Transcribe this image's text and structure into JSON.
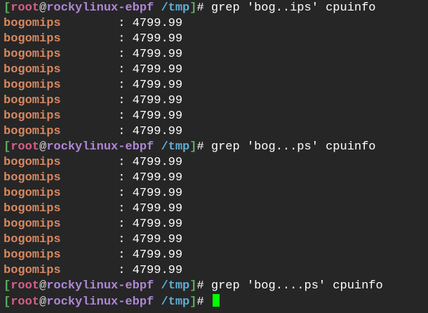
{
  "prompt": {
    "open": "[",
    "user": "root",
    "at": "@",
    "host": "rockylinux-ebpf",
    "path": "/tmp",
    "close": "]",
    "symbol": "# "
  },
  "lines": [
    {
      "type": "prompt",
      "command": "grep 'bog..ips' cpuinfo"
    },
    {
      "type": "output",
      "key": "bogomips",
      "sep": "        : ",
      "value": "4799.99"
    },
    {
      "type": "output",
      "key": "bogomips",
      "sep": "        : ",
      "value": "4799.99"
    },
    {
      "type": "output",
      "key": "bogomips",
      "sep": "        : ",
      "value": "4799.99"
    },
    {
      "type": "output",
      "key": "bogomips",
      "sep": "        : ",
      "value": "4799.99"
    },
    {
      "type": "output",
      "key": "bogomips",
      "sep": "        : ",
      "value": "4799.99"
    },
    {
      "type": "output",
      "key": "bogomips",
      "sep": "        : ",
      "value": "4799.99"
    },
    {
      "type": "output",
      "key": "bogomips",
      "sep": "        : ",
      "value": "4799.99"
    },
    {
      "type": "output",
      "key": "bogomips",
      "sep": "        : ",
      "value": "4799.99"
    },
    {
      "type": "prompt",
      "command": "grep 'bog...ps' cpuinfo"
    },
    {
      "type": "output",
      "key": "bogomips",
      "sep": "        : ",
      "value": "4799.99"
    },
    {
      "type": "output",
      "key": "bogomips",
      "sep": "        : ",
      "value": "4799.99"
    },
    {
      "type": "output",
      "key": "bogomips",
      "sep": "        : ",
      "value": "4799.99"
    },
    {
      "type": "output",
      "key": "bogomips",
      "sep": "        : ",
      "value": "4799.99"
    },
    {
      "type": "output",
      "key": "bogomips",
      "sep": "        : ",
      "value": "4799.99"
    },
    {
      "type": "output",
      "key": "bogomips",
      "sep": "        : ",
      "value": "4799.99"
    },
    {
      "type": "output",
      "key": "bogomips",
      "sep": "        : ",
      "value": "4799.99"
    },
    {
      "type": "output",
      "key": "bogomips",
      "sep": "        : ",
      "value": "4799.99"
    },
    {
      "type": "prompt",
      "command": "grep 'bog....ps' cpuinfo"
    },
    {
      "type": "prompt",
      "command": "",
      "cursor": true
    }
  ],
  "colors": {
    "background": "#262626",
    "bracket": "#5faf5f",
    "user": "#d75f87",
    "host": "#af87d7",
    "path": "#5fafd7",
    "key": "#d7875f",
    "text": "#ffffff",
    "cursor": "#00ff00"
  }
}
